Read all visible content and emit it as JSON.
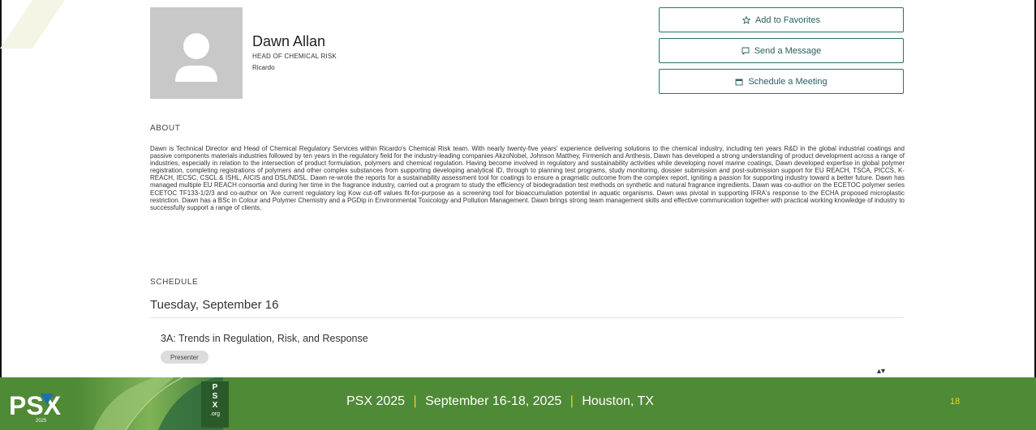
{
  "profile": {
    "name": "Dawn Allan",
    "title": "HEAD OF CHEMICAL RISK",
    "organization": "Ricardo"
  },
  "actions": {
    "favorites": "Add to Favorites",
    "message": "Send a Message",
    "meeting": "Schedule a Meeting"
  },
  "about": {
    "label": "ABOUT",
    "text": "Dawn is Technical Director and Head of Chemical Regulatory Services within Ricardo's Chemical Risk team. With nearly twenty-five years' experience delivering solutions to the chemical industry, including ten years R&D in the global industrial coatings and passive components materials industries followed by ten years in the regulatory field for the industry-leading companies AkzoNobel, Johnson Matthey, Firmenich and Anthesis, Dawn has developed a strong understanding of product development across a range of industries, especially in relation to the intersection of product formulation, polymers and chemical regulation. Having become involved in regulatory and sustainability activities while developing novel marine coatings, Dawn developed expertise in global polymer registration, completing registrations of polymers and other complex substances from supporting developing analytical ID, through to planning test programs, study monitoring, dossier submission and post-submission support for EU REACH, TSCA, PICCS, K-REACH, IECSC, CSCL & ISHL, AICIS and DSL/NDSL. Dawn re-wrote the reports for a sustainability assessment tool for coatings to ensure a pragmatic outcome from the complex report, igniting a passion for supporting industry toward a better future. Dawn has managed multiple EU REACH consortia and during her time in the fragrance industry, carried out a program to study the efficiency of biodegradation test methods on synthetic and natural fragrance ingredients. Dawn was co-author on the ECETOC polymer series ECETOC TF133-1/2/3 and co-author on 'Are current regulatory log Kow cut-off values fit-for-purpose as a screening tool for bioaccumulation potential in aquatic organisms. Dawn was pivotal in supporting IFRA's response to the ECHA proposed microplastic restriction. Dawn has a BSc in Colour and Polymer Chemistry and a PGDip in Environmental Toxicology and Pollution Management. Dawn brings strong team management skills and effective communication together with practical working knowledge of industry to successfully support a range of clients."
  },
  "schedule": {
    "label": "SCHEDULE",
    "day": "Tuesday, September 16",
    "session_title": "3A: Trends in Regulation, Risk, and Response",
    "role_badge": "Presenter"
  },
  "footer": {
    "event": "PSX 2025",
    "dates": "September 16-18, 2025",
    "location": "Houston, TX",
    "separator": "|",
    "slide_number": "18",
    "logo_text": "PSX",
    "logo_year": "2025",
    "org_letters": "PSX",
    "org_suffix": ".org"
  },
  "colors": {
    "accent": "#2f6f6f",
    "footer_bg": "#4f8a36",
    "footer_highlight": "#f2d21b"
  },
  "icons": {
    "favorites": "star-outline-icon",
    "message": "chat-bubble-icon",
    "meeting": "calendar-icon",
    "avatar": "person-placeholder-icon"
  }
}
